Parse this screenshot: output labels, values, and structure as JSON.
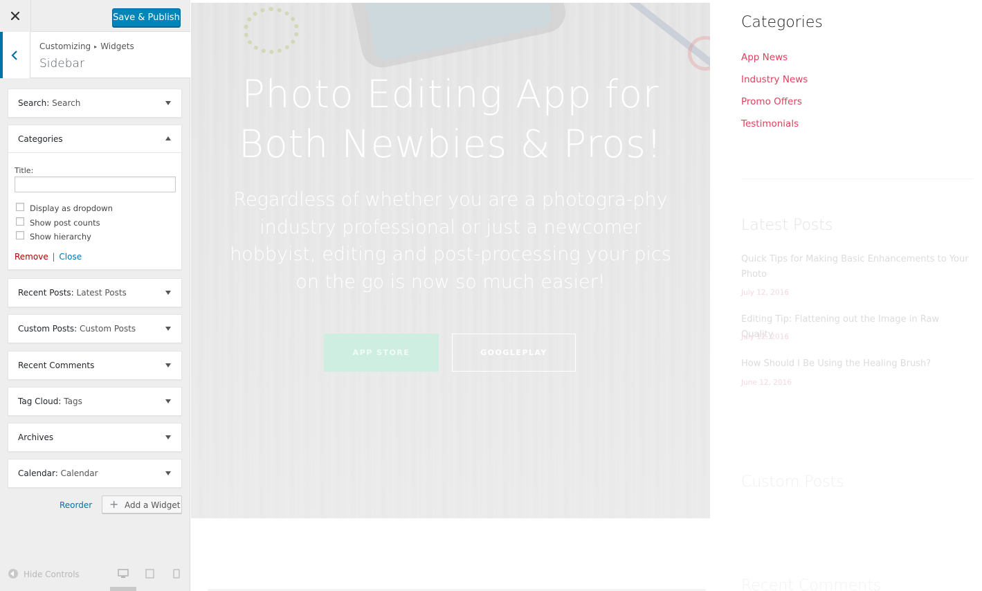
{
  "panel": {
    "header": {
      "close_label": "×",
      "publish_label": "Save & Publish"
    },
    "section": {
      "breadcrumb_root": "Customizing",
      "breadcrumb_sep": "▸",
      "breadcrumb_leaf": "Widgets",
      "title": "Sidebar"
    },
    "widgets": [
      {
        "name": "Search:",
        "sub": "Search"
      },
      {
        "name": "Categories",
        "sub": ""
      },
      {
        "name": "Recent Posts:",
        "sub": "Latest Posts"
      },
      {
        "name": "Custom Posts:",
        "sub": "Custom Posts"
      },
      {
        "name": "Recent Comments",
        "sub": ""
      },
      {
        "name": "Tag Cloud:",
        "sub": "Tags"
      },
      {
        "name": "Archives",
        "sub": ""
      },
      {
        "name": "Calendar:",
        "sub": "Calendar"
      }
    ],
    "categories_form": {
      "title_label": "Title:",
      "title_value": "",
      "options": [
        {
          "label": "Display as dropdown",
          "checked": false
        },
        {
          "label": "Show post counts",
          "checked": false
        },
        {
          "label": "Show hierarchy",
          "checked": false
        }
      ],
      "remove_label": "Remove",
      "separator": "|",
      "close_label": "Close"
    },
    "reorder_label": "Reorder",
    "add_widget_label": "Add a Widget",
    "footer": {
      "hide_controls_label": "Hide Controls"
    },
    "colors": {
      "accent": "#0085ba",
      "link": "#0073aa",
      "danger": "#aa0000"
    }
  },
  "preview": {
    "hero": {
      "headline_line1": "Photo Editing App for",
      "headline_line2": "Both Newbies & Pros!",
      "body": "Regardless of whether you are a photogra-phy industry professional or just a newcomer hobbyist, editing and post-processing your pics on the go is now so much easier!",
      "primary_button": "APP STORE",
      "secondary_button": "GOOGLEPLAY"
    },
    "sidebar": {
      "categories_title": "Categories",
      "categories": [
        "App News",
        "Industry News",
        "Promo Offers",
        "Testimonials"
      ],
      "latest_title": "Latest Posts",
      "posts": [
        {
          "title": "Quick Tips for Making Basic Enhancements to Your Photo",
          "date": "July 12, 2016"
        },
        {
          "title": "Editing Tip: Flattening out the Image in Raw Quality",
          "date": "July 12, 2016"
        },
        {
          "title": "How Should I Be Using the Healing Brush?",
          "date": "June 12, 2016"
        }
      ],
      "custom_title": "Custom Posts",
      "comments_title": "Recent Comments",
      "colors": {
        "category_link": "#e0405c"
      }
    }
  }
}
